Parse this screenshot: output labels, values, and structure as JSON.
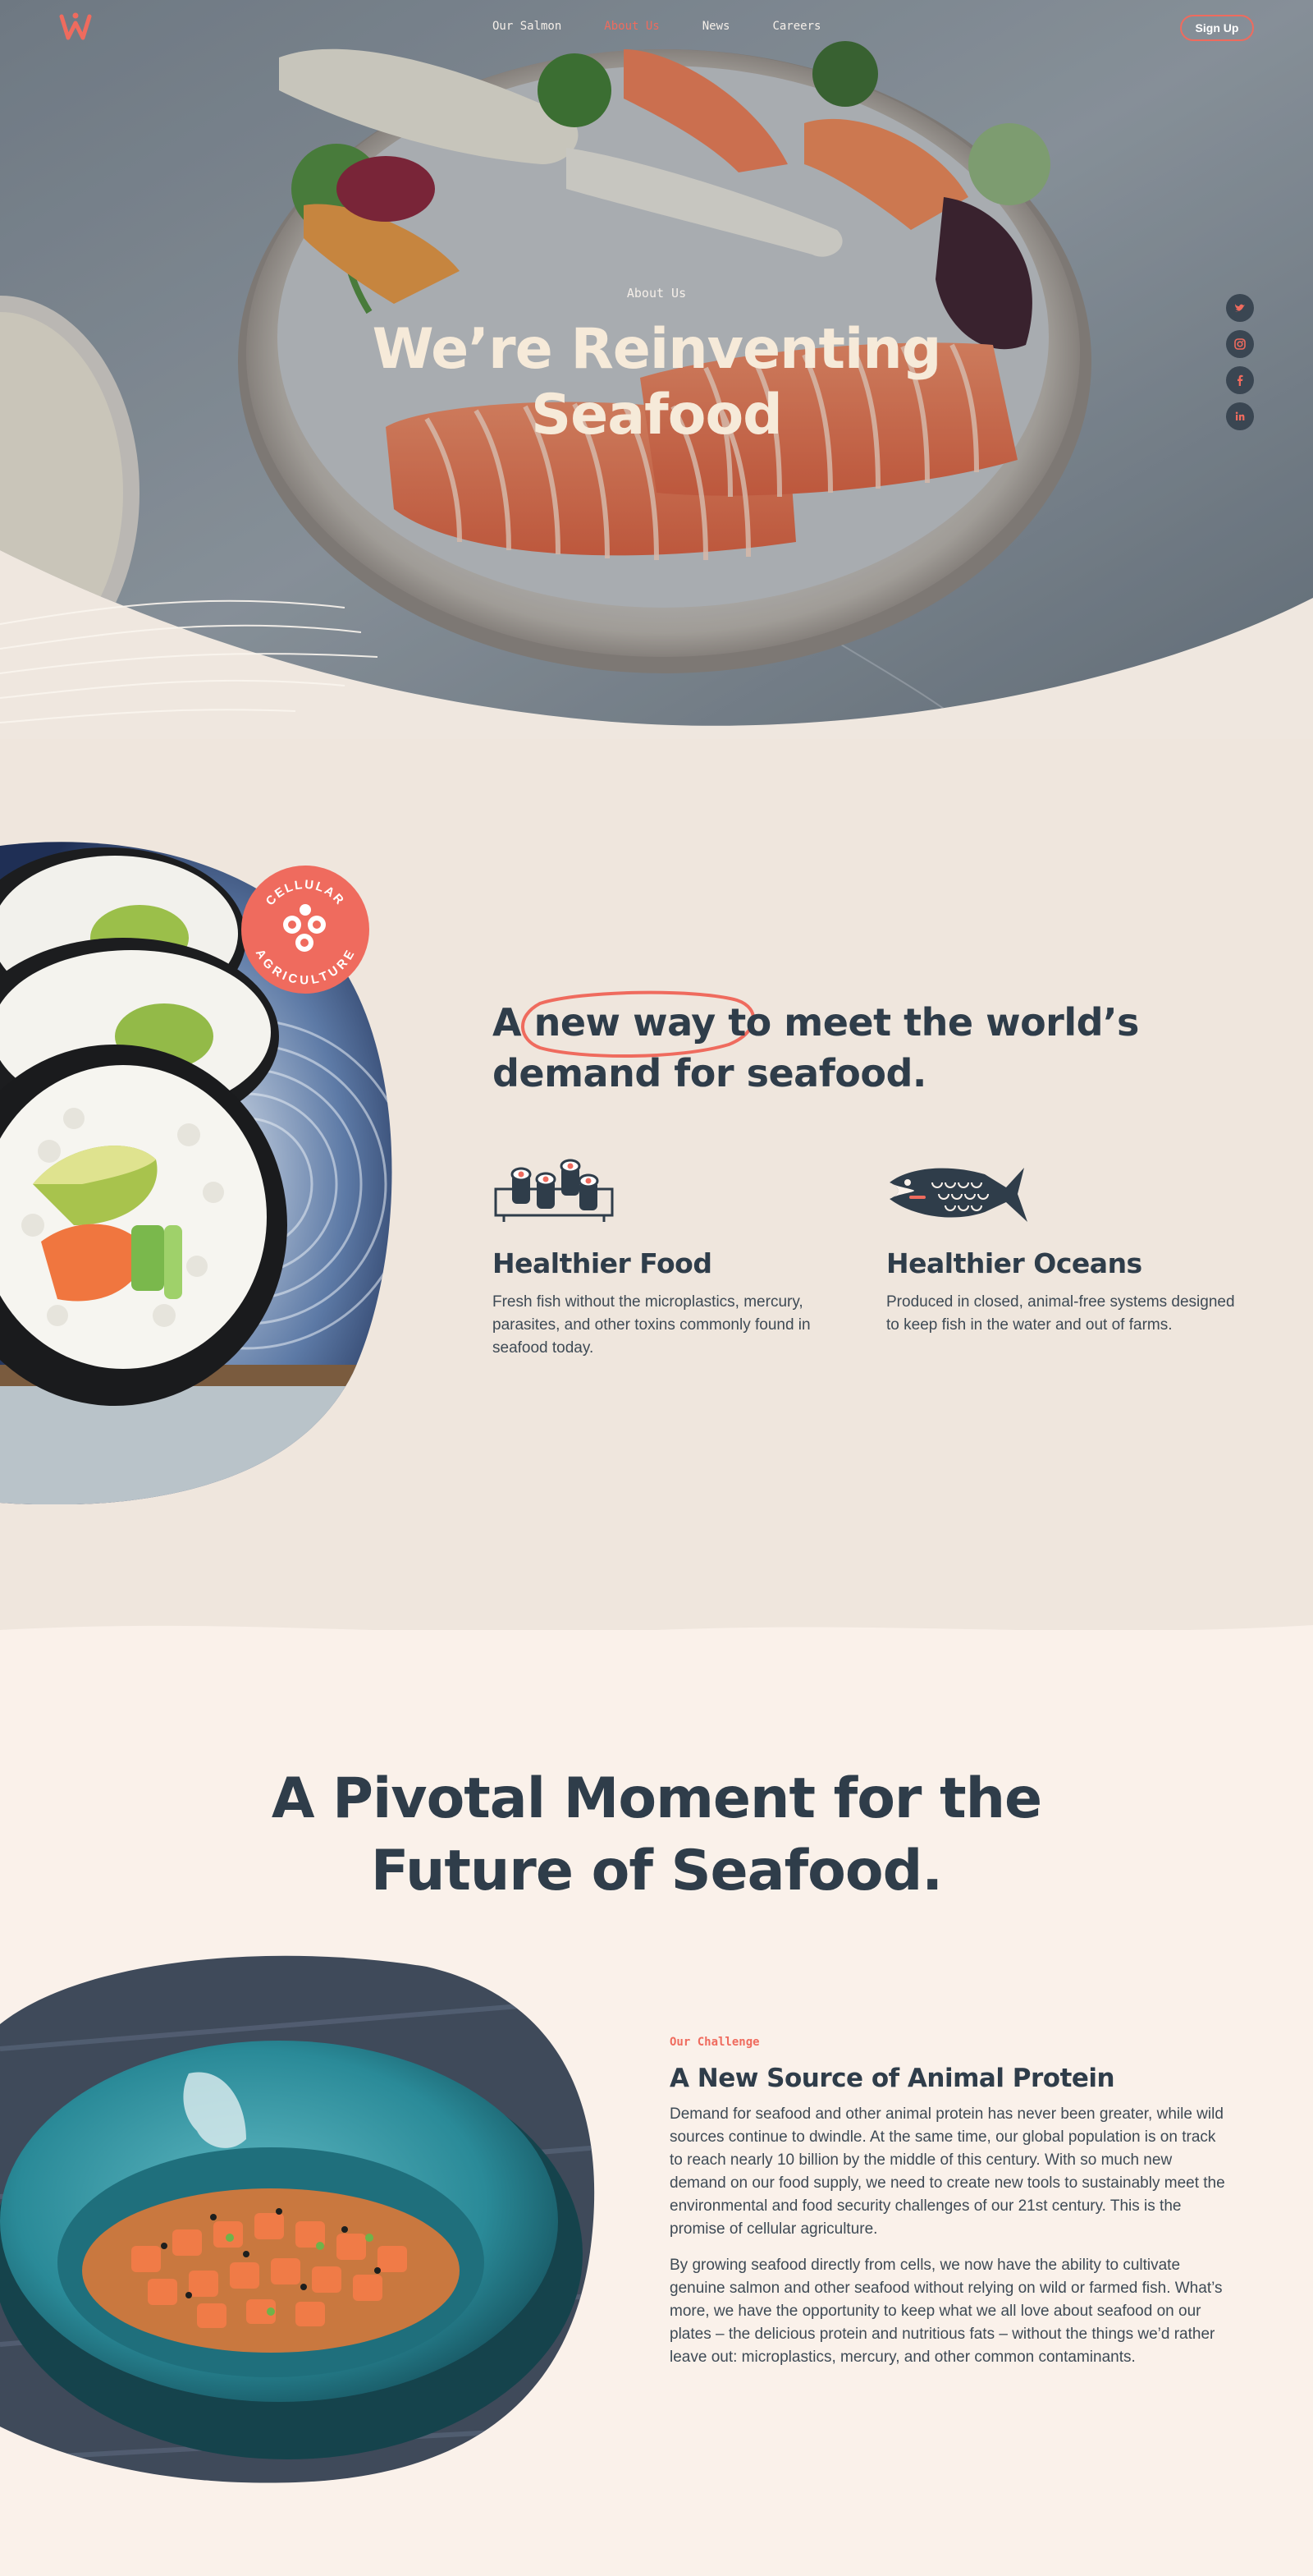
{
  "nav": {
    "logo_alt": "W",
    "links": [
      {
        "label": "Our Salmon"
      },
      {
        "label": "About Us"
      },
      {
        "label": "News"
      },
      {
        "label": "Careers"
      }
    ],
    "signup_label": "Sign Up"
  },
  "hero": {
    "eyebrow": "About Us",
    "title": "We’re Reinventing Seafood"
  },
  "social": [
    "twitter-icon",
    "instagram-icon",
    "facebook-icon",
    "linkedin-icon"
  ],
  "mission": {
    "badge_top": "CELLULAR",
    "badge_bottom": "AGRICULTURE",
    "title": "A new way to meet the world’s demand for seafood.",
    "features": [
      {
        "icon": "sushi-plate-icon",
        "title": "Healthier Food",
        "text": "Fresh fish without the microplastics, mercury, parasites, and other toxins commonly found in seafood today."
      },
      {
        "icon": "fish-icon",
        "title": "Healthier Oceans",
        "text": "Produced in closed, animal-free systems designed to keep fish in the water and out of farms."
      }
    ]
  },
  "pivotal": {
    "title": "A Pivotal Moment for the Future of Seafood.",
    "eyebrow": "Our Challenge",
    "heading": "A New Source of Animal Protein",
    "paragraphs": [
      "Demand for seafood and other animal protein has never been greater, while wild sources continue to dwindle. At the same time, our global population is on track to reach nearly 10 billion by the middle of this century. With so much new demand on our food supply, we need to create new tools to sustainably meet the environmental and food security challenges of our 21st century. This is the promise of cellular agriculture.",
      "By growing seafood directly from cells, we now have the ability to cultivate genuine salmon and other seafood without relying on wild or farmed fish. What’s more, we have the opportunity to keep what we all love about seafood on our plates – the delicious protein and nutritious fats – without the things we’d rather leave out: microplastics, mercury, and other common contaminants."
    ]
  },
  "colors": {
    "accent": "#ef6b5e",
    "navy": "#2f3d4a",
    "cream": "#faf1ea",
    "sand": "#efe6dd"
  }
}
